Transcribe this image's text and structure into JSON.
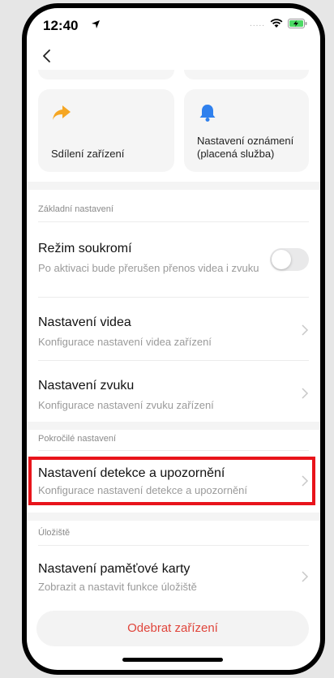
{
  "status_bar": {
    "time": "12:40",
    "signal": "....."
  },
  "quick_actions": [
    {
      "label": "Sdílení zařízení",
      "icon": "share-arrow-icon",
      "color": "#f5a623"
    },
    {
      "label": "Nastavení oznámení\n(placená služba)",
      "icon": "bell-icon",
      "color": "#2f80ed"
    }
  ],
  "sections": {
    "basic": {
      "title": "Základní nastavení",
      "privacy": {
        "title": "Režim soukromí",
        "subtitle": "Po aktivaci bude přerušen přenos videa i zvuku",
        "enabled": false
      },
      "video": {
        "title": "Nastavení videa",
        "subtitle": "Konfigurace nastavení videa zařízení"
      },
      "audio": {
        "title": "Nastavení zvuku",
        "subtitle": "Konfigurace nastavení zvuku zařízení"
      }
    },
    "advanced": {
      "title": "Pokročilé nastavení",
      "detection": {
        "title": "Nastavení detekce a upozornění",
        "subtitle": "Konfigurace nastavení detekce a upozornění"
      }
    },
    "storage": {
      "title": "Úložiště",
      "memory_card": {
        "title": "Nastavení paměťové karty",
        "subtitle": "Zobrazit a nastavit funkce úložiště"
      }
    }
  },
  "remove_button": "Odebrat zařízení",
  "colors": {
    "accent_red": "#e0453b",
    "highlight": "#e8141b"
  }
}
